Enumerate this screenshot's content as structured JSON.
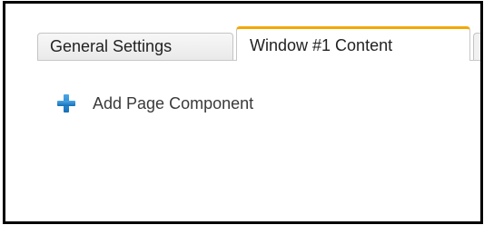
{
  "tabs": [
    {
      "label": "General Settings",
      "active": false
    },
    {
      "label": "Window #1 Content",
      "active": true
    }
  ],
  "panel": {
    "add_component_label": "Add Page Component",
    "add_icon": "plus-icon"
  },
  "colors": {
    "active_tab_accent": "#f2a800",
    "plus_icon": "#1b86d2"
  }
}
